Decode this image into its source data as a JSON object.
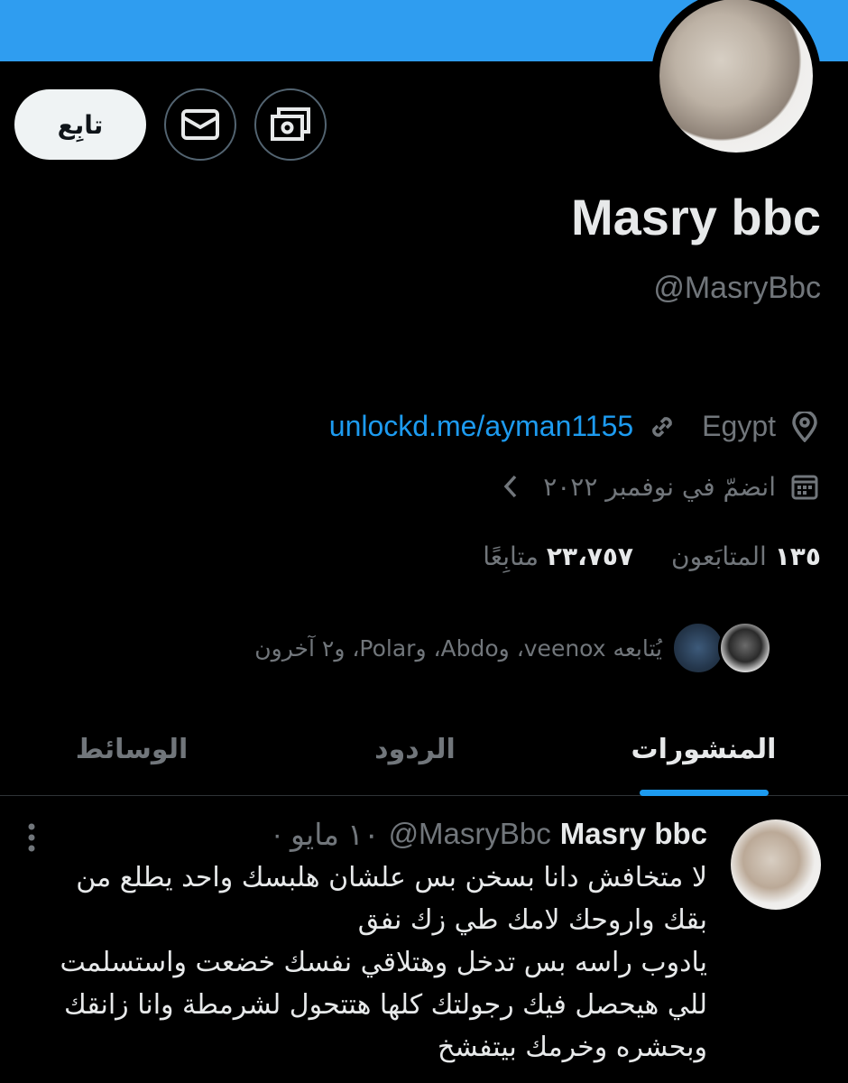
{
  "colors": {
    "banner": "#2f9df0",
    "accent": "#1d9bf0",
    "muted": "#71767b",
    "text": "#e7e9ea"
  },
  "profile": {
    "name": "Masry bbc",
    "handle": "@MasryBbc",
    "follow_label": "تابِع",
    "location": "Egypt",
    "website": "unlockd.me/ayman1155",
    "joined": "انضمّ في نوفمبر ٢٠٢٢",
    "following_count": "١٣٥",
    "following_label": "المتابَعون",
    "followers_count": "٢٣،٧٥٧",
    "followers_label": "متابِعًا",
    "followed_by": "يُتابعه veenox، وAbdo، وPolar، و٢ آخرون"
  },
  "icons": [
    "money-icon",
    "mail-icon",
    "location-icon",
    "link-icon",
    "calendar-icon",
    "chevron-left-icon",
    "more-icon"
  ],
  "tabs": [
    {
      "label": "المنشورات",
      "active": true
    },
    {
      "label": "الردود",
      "active": false
    },
    {
      "label": "الوسائط",
      "active": false
    }
  ],
  "post": {
    "name": "Masry bbc",
    "handle": "@MasryBbc",
    "date": "· ١٠ مايو",
    "lines": [
      "لا متخافش دانا بسخن بس علشان هلبسك واحد يطلع من",
      "بقك واروحك لامك طي زك نفق",
      "يادوب راسه بس تدخل وهتلاقي نفسك خضعت واستسلمت",
      "للي هيحصل فيك رجولتك كلها هتتحول لشرمطة وانا زانقك",
      "وبحشره وخرمك بيتفشخ"
    ]
  }
}
